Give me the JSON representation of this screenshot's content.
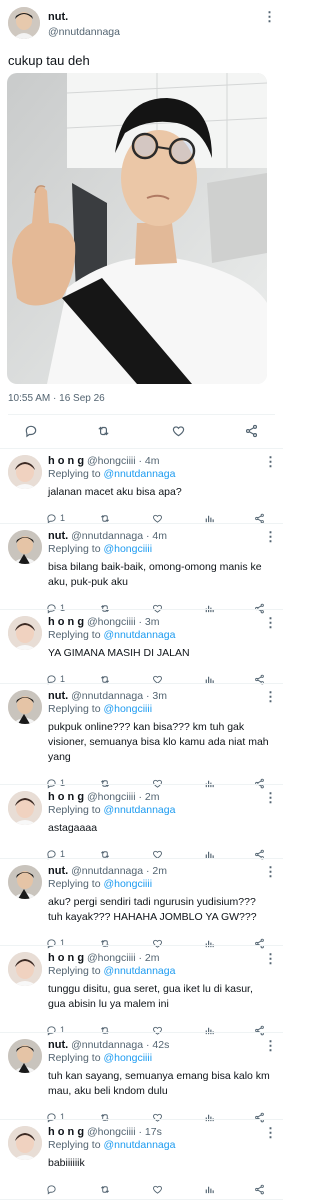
{
  "main_tweet": {
    "name": "nut.",
    "handle": "@nnutdannaga",
    "text": "cukup tau deh",
    "timestamp": "10:55 AM · 16 Sep 26"
  },
  "replies": [
    {
      "name": "h o n g",
      "handle": "@hongciiii",
      "time": "4m",
      "replying_to": "@nnutdannaga",
      "lines": [
        "jalanan macet aku bisa apa?"
      ],
      "reply_count": "1"
    },
    {
      "name": "nut.",
      "handle": "@nnutdannaga",
      "time": "4m",
      "replying_to": "@hongciiii",
      "lines": [
        "bisa bilang baik-baik, omong-omong manis ke",
        "aku, puk-puk aku"
      ],
      "reply_count": "1"
    },
    {
      "name": "h o n g",
      "handle": "@hongciiii",
      "time": "3m",
      "replying_to": "@nnutdannaga",
      "lines": [
        "YA GIMANA MASIH DI JALAN"
      ],
      "reply_count": "1"
    },
    {
      "name": "nut.",
      "handle": "@nnutdannaga",
      "time": "3m",
      "replying_to": "@hongciiii",
      "lines": [
        "pukpuk online??? kan bisa??? km tuh gak",
        "visioner, semuanya bisa klo kamu ada niat mah",
        "yang"
      ],
      "reply_count": "1"
    },
    {
      "name": "h o n g",
      "handle": "@hongciiii",
      "time": "2m",
      "replying_to": "@nnutdannaga",
      "lines": [
        "astagaaaa"
      ],
      "reply_count": "1"
    },
    {
      "name": "nut.",
      "handle": "@nnutdannaga",
      "time": "2m",
      "replying_to": "@hongciiii",
      "lines": [
        "aku? pergi sendiri tadi ngurusin yudisium???",
        "tuh kayak??? HAHAHA JOMBLO YA GW???"
      ],
      "reply_count": "1"
    },
    {
      "name": "h o n g",
      "handle": "@hongciiii",
      "time": "2m",
      "replying_to": "@nnutdannaga",
      "lines": [
        "tunggu disitu, gua seret, gua iket lu di kasur,",
        "gua abisin lu ya malem ini"
      ],
      "reply_count": "1"
    },
    {
      "name": "nut.",
      "handle": "@nnutdannaga",
      "time": "42s",
      "replying_to": "@hongciiii",
      "lines": [
        "tuh kan sayang, semuanya emang bisa kalo km",
        "mau, aku beli kndom dulu"
      ],
      "reply_count": "1"
    },
    {
      "name": "h o n g",
      "handle": "@hongciiii",
      "time": "17s",
      "replying_to": "@nnutdannaga",
      "lines": [
        "babiiiiiik"
      ],
      "reply_count": ""
    }
  ],
  "labels": {
    "replying_to": "Replying to",
    "dot": "·"
  },
  "colors": {
    "link": "#1d9bf0",
    "secondary_text": "#536471",
    "divider": "#eff3f4"
  },
  "icons": [
    "more-icon",
    "reply-icon",
    "retweet-icon",
    "like-icon",
    "analytics-icon",
    "share-icon"
  ]
}
